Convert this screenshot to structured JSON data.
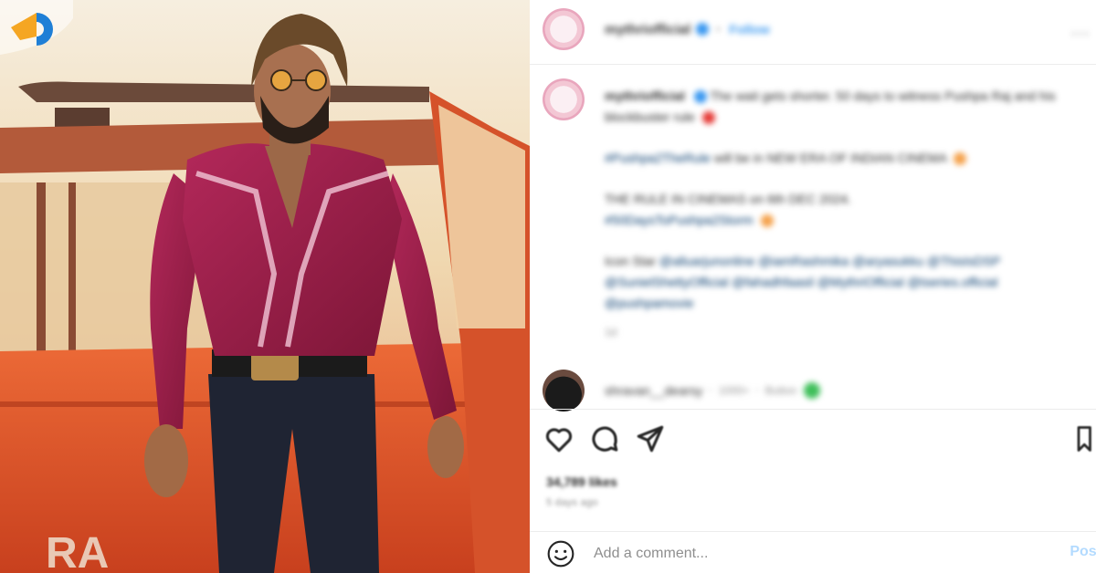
{
  "post": {
    "username": "mythriofficial",
    "follow_label": "Follow",
    "more_label": "...",
    "caption": {
      "username": "mythriofficial",
      "line1": "The wait gets shorter. 50 days to witness Pushpa Raj and his blockbuster rule",
      "line2_tag": "#Pushpa2TheRule",
      "line2_text": " will be in NEW ERA OF INDIAN CINEMA",
      "line3": "THE RULE IN CINEMAS on 6th DEC 2024.",
      "line3_tag": "#50DaysToPushpa2Storm",
      "line4_prefix": "Icon Star ",
      "line4_tags": "@alluarjunonline @iamRashmika @aryasukku @ThisIsDSP @SunielShettyOfficial @fahadhfaasil @MythriOfficial @tseries.official @pushpamovie",
      "meta": "1d"
    },
    "comment": {
      "username": "shravan__dearsy",
      "follower_text": "1000+",
      "follow_label": "Button"
    },
    "likes": "34,789 likes",
    "time_ago": "5 days ago",
    "add_comment_placeholder": "Add a comment...",
    "post_button": "Post"
  },
  "icons": {
    "heart": "heart-icon",
    "comment": "comment-icon",
    "share": "share-icon",
    "bookmark": "bookmark-icon",
    "emoji": "emoji-icon",
    "logo": "site-logo-icon"
  },
  "colors": {
    "accent": "#3897f0",
    "shirt": "#9c1e46",
    "car": "#e0522a"
  }
}
